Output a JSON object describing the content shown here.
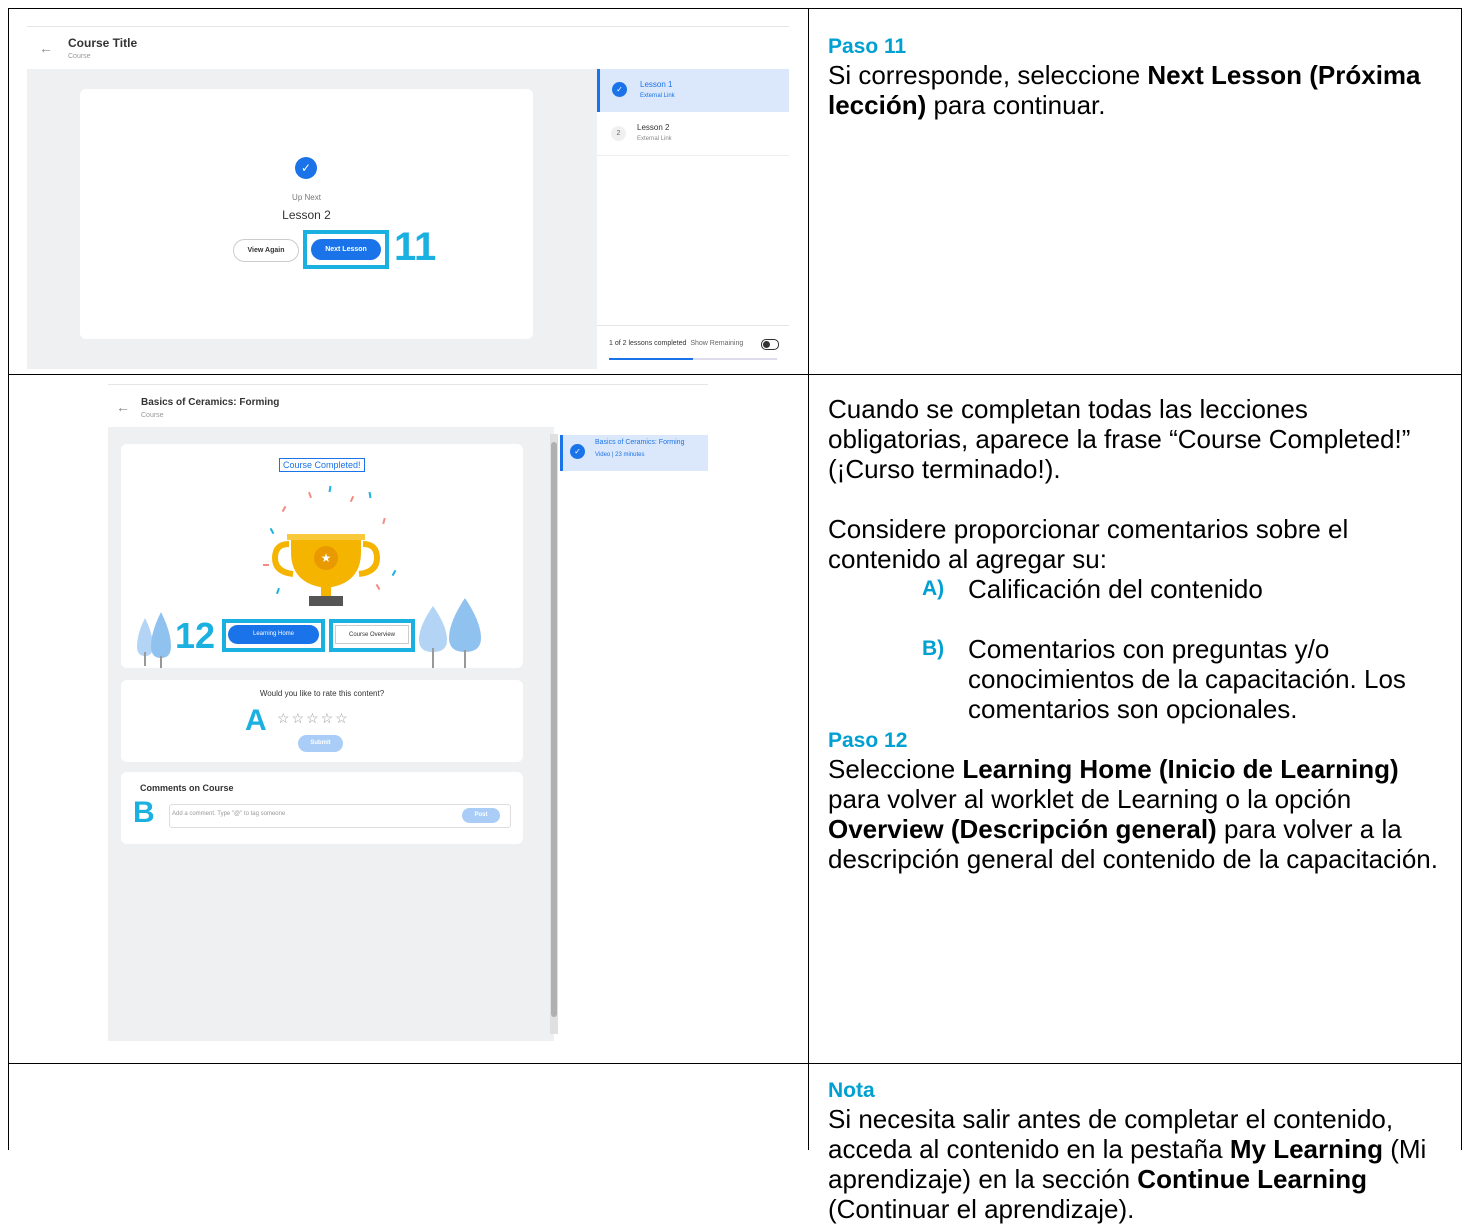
{
  "row1": {
    "screenshot": {
      "course_title": "Course Title",
      "course_sub": "Course",
      "up_next": "Up Next",
      "next_lesson_name": "Lesson 2",
      "view_again": "View Again",
      "next_lesson_btn": "Next Lesson",
      "callout": "11",
      "lessons": [
        {
          "name": "Lesson 1",
          "sub": "External Link",
          "completed": true
        },
        {
          "name": "Lesson 2",
          "sub": "External Link",
          "number": "2"
        }
      ],
      "progress_text": "1 of 2 lessons completed",
      "show_remaining": "Show Remaining",
      "progress_fraction": 0.5
    },
    "step_title": "Paso 11",
    "text_plain1": "Si corresponde, seleccione ",
    "text_bold1": "Next Lesson (Próxima lección)",
    "text_plain2": " para continuar."
  },
  "row2": {
    "screenshot": {
      "course_title": "Basics of Ceramics: Forming",
      "course_sub": "Course",
      "completed_label": "Course Completed!",
      "learning_home": "Learning Home",
      "course_overview": "Course Overview",
      "callout": "12",
      "rate_question": "Would you like to rate this content?",
      "callout_a": "A",
      "stars": "☆☆☆☆☆",
      "submit": "Submit",
      "comments_heading": "Comments on Course",
      "callout_b": "B",
      "comment_placeholder": "Add a comment. Type \"@\" to tag someone",
      "post": "Post",
      "side_title": "Basics of Ceramics: Forming",
      "side_sub": "Video  |  23 minutes"
    },
    "p1": "Cuando se completan todas las lecciones obligatorias, aparece la frase “Course Completed!” (¡Curso terminado!).",
    "p2": "Considere proporcionar comentarios sobre el contenido al agregar su:",
    "item_a_label": "A)",
    "item_a_text": "Calificación del contenido",
    "item_b_label": "B)",
    "item_b_text": "Comentarios con preguntas y/o conocimientos de la capacitación. Los comentarios son opcionales.",
    "step_title": "Paso 12",
    "s12_plain1": "Seleccione ",
    "s12_bold1": "Learning Home (Inicio de Learning)",
    "s12_plain2": " para volver al worklet de Learning o la opción ",
    "s12_bold2": "Overview (Descripción general)",
    "s12_plain3": " para volver a la descripción general del contenido de la capacitación."
  },
  "row3": {
    "title": "Nota",
    "plain1": "Si necesita salir antes de completar el contenido, acceda al contenido en la pestaña ",
    "bold1": "My Learning",
    "plain2": " (Mi aprendizaje) en la sección ",
    "bold2": "Continue Learning",
    "plain3": " (Continuar el aprendizaje)."
  },
  "colors": {
    "accent": "#00a0d2",
    "highlight": "#1ab0e0",
    "blue": "#1a73e8"
  }
}
